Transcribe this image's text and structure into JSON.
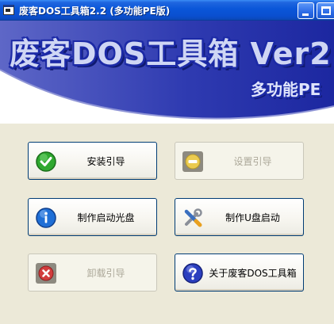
{
  "window": {
    "title": "废客DOS工具箱2.2 (多功能PE版)",
    "accent": "#0a56d8"
  },
  "banner": {
    "title": "废客DOS工具箱 Ver2.",
    "subtitle": "多功能PE"
  },
  "buttons": [
    {
      "label": "安装引导",
      "icon": "check-icon",
      "enabled": true,
      "color": "#2fa82f"
    },
    {
      "label": "设置引导",
      "icon": "minus-icon",
      "enabled": false,
      "color": "#e8c23a"
    },
    {
      "label": "制作启动光盘",
      "icon": "info-icon",
      "enabled": true,
      "color": "#1f6fd6"
    },
    {
      "label": "制作U盘启动",
      "icon": "tools-icon",
      "enabled": true,
      "color": "#3a6fbf"
    },
    {
      "label": "卸载引导",
      "icon": "close-icon",
      "enabled": false,
      "color": "#d23c3c"
    },
    {
      "label": "关于废客DOS工具箱",
      "icon": "help-icon",
      "enabled": true,
      "color": "#2b3fbf"
    }
  ]
}
